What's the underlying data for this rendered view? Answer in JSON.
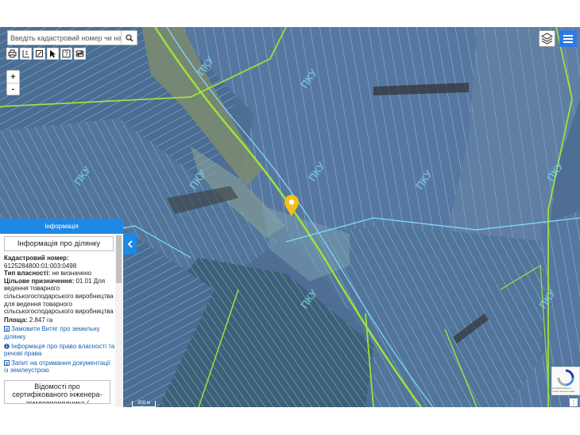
{
  "search": {
    "placeholder": "Введіть кадастровий номер чи населе"
  },
  "toolbar": {
    "icons": [
      "print-icon",
      "measure-length-icon",
      "measure-area-icon",
      "pointer-icon",
      "identify-icon",
      "layers-toggle-icon"
    ]
  },
  "zoom": {
    "in_label": "+",
    "out_label": "-"
  },
  "map": {
    "watermarks": [
      "ПКУ",
      "ПКУ",
      "ПКУ",
      "ПКУ",
      "ПКУ",
      "ПКУ",
      "ПКУ",
      "ПКУ",
      "ПКУ"
    ],
    "scale_label": "300 м",
    "marker_color": "#f2c01c"
  },
  "info_panel": {
    "header": "Інформація",
    "title": "Інформація про ділянку",
    "cadastral_label": "Кадастровий номер:",
    "cadastral_value": "6125284800:01:003:0498",
    "ownership_label": "Тип власності:",
    "ownership_value": "не визначено",
    "purpose_label": "Цільове призначення:",
    "purpose_value": "01.01 Для ведення товарного сільськогосподарського виробництва для ведення товарного сільськогосподарського виробництва",
    "area_label": "Площа:",
    "area_value": "2.847 га",
    "links": [
      "Замовити Витяг про земельну ділянку",
      "Інформація про право власності та речові права",
      "Запит на отримання документації із землеустрою"
    ],
    "cert_title": "Відомості про сертифікованого інженера-землевпорядника / БЕЗОСОБЕДЦІЙ ВИКОНАВЕЦЬ"
  },
  "recaptcha": {
    "text": "Конфіденційність - Умови використання"
  },
  "colors": {
    "accent": "#1e88e5",
    "parcel_line": "#7fe0ff",
    "boundary": "#9be33a"
  }
}
